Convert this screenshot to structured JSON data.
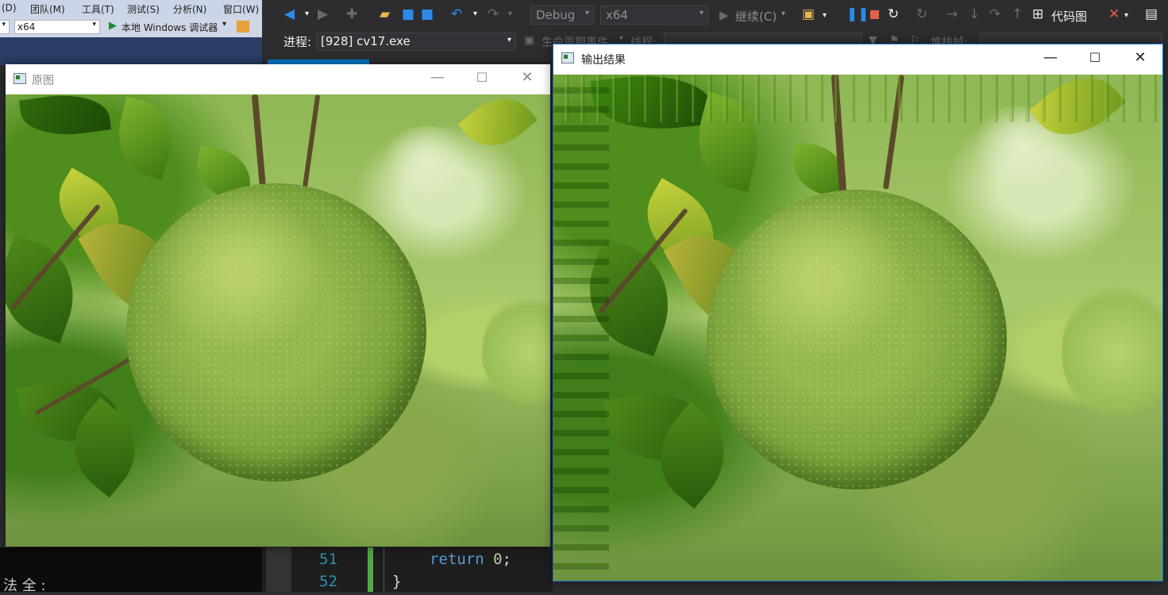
{
  "left_menu": [
    {
      "label": "(D)"
    },
    {
      "label": "团队(M)"
    },
    {
      "label": "工具(T)"
    },
    {
      "label": "测试(S)"
    },
    {
      "label": "分析(N)"
    },
    {
      "label": "窗口(W)"
    }
  ],
  "left_toolbar": {
    "platform": "x64",
    "run_label": "本地 Windows 调试器"
  },
  "vs_toolbar": {
    "config": "Debug",
    "platform": "x64",
    "continue_label": "继续(C)",
    "code_map_label": "代码图"
  },
  "debug_row": {
    "process_label": "进程:",
    "process_value": "[928] cv17.exe",
    "lifecycle_label": "生命周期事件",
    "thread_label": "线程:",
    "stack_label": "堆栈帧:"
  },
  "console": {
    "text": "法 全 :"
  },
  "code": {
    "lines": [
      {
        "number": "51",
        "keyword": "return",
        "value": "0",
        "suffix": ";"
      },
      {
        "number": "52",
        "text": "}"
      }
    ]
  },
  "window_original": {
    "title": "原图",
    "icon": "opencv-window-icon"
  },
  "window_output": {
    "title": "输出结果",
    "icon": "opencv-window-icon"
  },
  "colors": {
    "accent": "#007acc",
    "line_number": "#2b91af",
    "keyword": "#569cd6",
    "number": "#b5cea8"
  }
}
